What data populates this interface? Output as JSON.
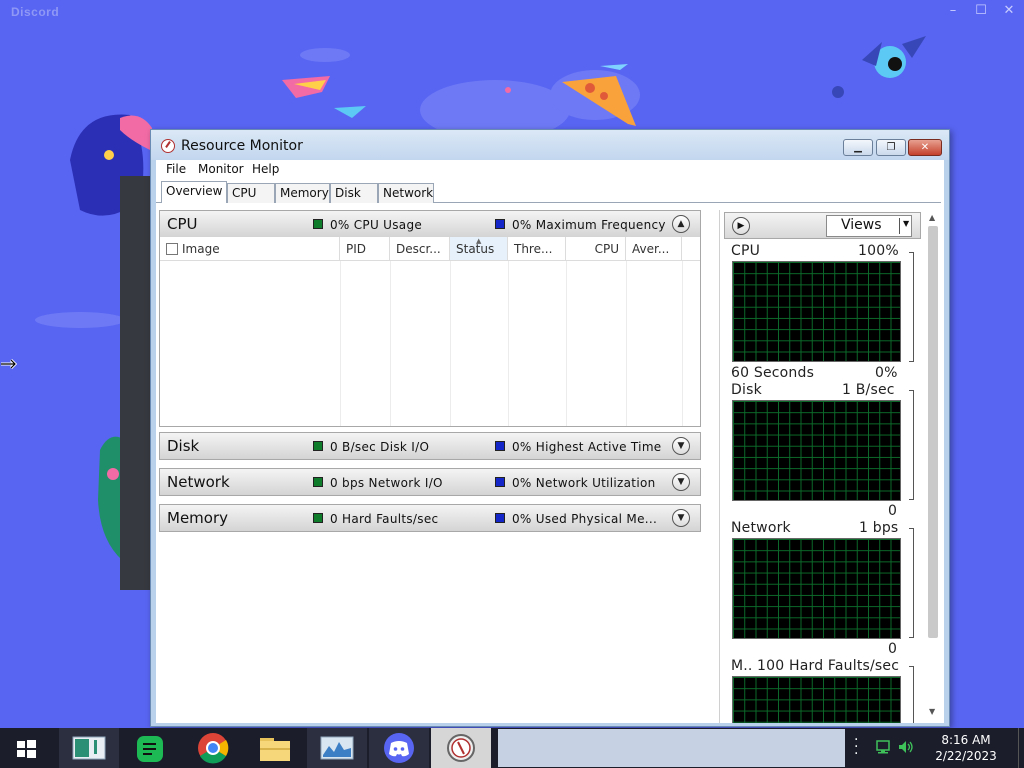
{
  "discord": {
    "title": "Discord",
    "controls": {
      "minimize": "–",
      "maximize": "☐",
      "close": "✕"
    }
  },
  "resource_monitor": {
    "title": "Resource Monitor",
    "controls": {
      "minimize": "▁",
      "restore": "❐",
      "close": "✕"
    },
    "menu": [
      "File",
      "Monitor",
      "Help"
    ],
    "tabs": [
      "Overview",
      "CPU",
      "Memory",
      "Disk",
      "Network"
    ],
    "active_tab": "Overview",
    "sections": {
      "cpu": {
        "title": "CPU",
        "stat1": "0% CPU Usage",
        "stat2": "0% Maximum Frequency",
        "expanded": true
      },
      "disk": {
        "title": "Disk",
        "stat1": "0 B/sec Disk I/O",
        "stat2": "0% Highest Active Time",
        "expanded": false
      },
      "network": {
        "title": "Network",
        "stat1": "0 bps Network I/O",
        "stat2": "0% Network Utilization",
        "expanded": false
      },
      "memory": {
        "title": "Memory",
        "stat1": "0 Hard Faults/sec",
        "stat2": "0% Used Physical Me...",
        "expanded": false
      }
    },
    "cpu_table": {
      "columns": [
        "Image",
        "PID",
        "Descr...",
        "Status",
        "Thre...",
        "CPU",
        "Aver..."
      ],
      "sorted_column": "Status",
      "rows": []
    },
    "views_panel": {
      "views_button": "Views",
      "graphs": {
        "cpu": {
          "label": "CPU",
          "max": "100%",
          "time": "60 Seconds",
          "min": "0%"
        },
        "disk": {
          "label": "Disk",
          "max": "1 B/sec",
          "min": "0"
        },
        "network": {
          "label": "Network",
          "max": "1 bps",
          "min": "0"
        },
        "memory": {
          "label": "M..",
          "max": "100 Hard Faults/sec"
        }
      }
    }
  },
  "taskbar": {
    "clock_time": "8:16 AM",
    "clock_date": "2/22/2023",
    "apps": [
      "start",
      "tablet-app",
      "notes",
      "chrome",
      "file-explorer",
      "resource-monitor",
      "discord",
      "active-app"
    ]
  },
  "colors": {
    "discord_bg": "#5865f2",
    "legend_green": "#0f7c2c",
    "legend_blue": "#1526c8",
    "graph_grid": "#0c6a2a"
  }
}
